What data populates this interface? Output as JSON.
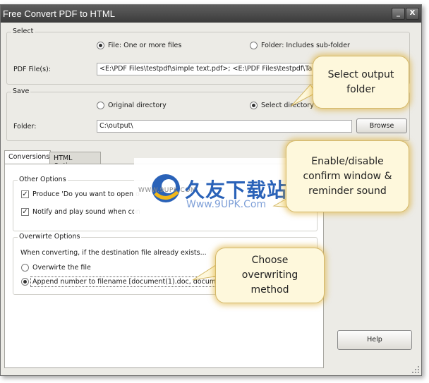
{
  "window": {
    "title": "Free Convert PDF to HTML",
    "minimize": "_",
    "close": "X"
  },
  "select_group": {
    "label": "Select",
    "file_option": "File:  One or more files",
    "folder_option": "Folder: Includes sub-folder",
    "selected": "file",
    "pdf_label": "PDF File(s):",
    "pdf_value": "<E:\\PDF Files\\testpdf\\simple text.pdf>; <E:\\PDF Files\\testpdf\\Table.pd"
  },
  "save_group": {
    "label": "Save",
    "original_option": "Original directory",
    "select_option": "Select directory",
    "selected": "select",
    "folder_label": "Folder:",
    "folder_value": "C:\\output\\",
    "browse_button": "Browse"
  },
  "tabs": [
    {
      "label": "Conversions",
      "active": true
    },
    {
      "label": "HTML Options",
      "active": false
    }
  ],
  "other_options": {
    "label": "Other Options",
    "items": [
      {
        "label": "Produce 'Do you want to open o",
        "checked": true
      },
      {
        "label": "Notify and play sound when con",
        "checked": true
      }
    ]
  },
  "overwrite_options": {
    "label": "Overwirte Options",
    "description": "When converting, if the destination file already exists...",
    "options": [
      {
        "label": "Overwirte the file",
        "selected": false
      },
      {
        "label": "Append number to filename  [document(1).doc, documen",
        "selected": true
      }
    ]
  },
  "help_button": "Help",
  "callouts": {
    "output_folder": "Select output\nfolder",
    "confirm": "Enable/disable\nconfirm window &\nreminder sound",
    "overwrite": "Choose\noverwriting\nmethod"
  },
  "watermark": {
    "url": "WWW.9UPK.COM",
    "chinese": "久友下载站",
    "domain": "Www.9UPK.Com"
  }
}
